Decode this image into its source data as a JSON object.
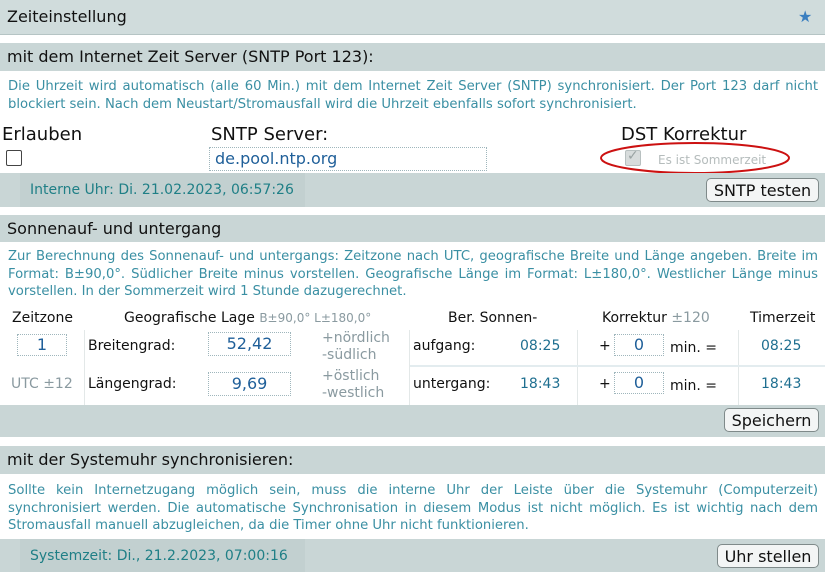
{
  "page": {
    "title": "Zeiteinstellung",
    "star_icon": "star-icon"
  },
  "sntp": {
    "title": "mit dem Internet Zeit Server (SNTP Port 123):",
    "description": "Die Uhrzeit wird automatisch (alle 60 Min.) mit dem Internet Zeit Server (SNTP) synchronisiert. Der Port 123 darf nicht blockiert sein. Nach dem Neustart/Stromausfall wird die Uhrzeit ebenfalls sofort synchronisiert.",
    "allow_label": "Erlauben",
    "allow_checked": false,
    "server_label": "SNTP Server:",
    "server_value": "de.pool.ntp.org",
    "dst_label": "DST Korrektur",
    "dst_checked": true,
    "dst_text": "Es ist Sommerzeit",
    "internal_clock": "Interne Uhr: Di. 21.02.2023, 06:57:26",
    "test_button": "SNTP testen"
  },
  "sun": {
    "title": "Sonnenauf- und untergang",
    "description": "Zur Berechnung des Sonnenauf- und untergangs: Zeitzone nach UTC, geografische Breite und Länge angeben. Breite im Format: B±90,0°. Südlicher Breite minus vorstellen. Geografische Länge im Format: L±180,0°. Westlicher Länge minus vorstellen. In der Sommerzeit wird 1 Stunde dazugerechnet.",
    "headers": {
      "timezone": "Zeitzone",
      "geo": "Geografische Lage",
      "geo_hint": "B±90,0° L±180,0°",
      "sun": "Ber. Sonnen-",
      "correction": "Korrektur",
      "correction_hint": "±120",
      "timer": "Timerzeit"
    },
    "timezone_value": "1",
    "timezone_hint": "UTC ±12",
    "lat_label": "Breitengrad:",
    "lat_value": "52,42",
    "lat_hint_1": "+nördlich",
    "lat_hint_2": "-südlich",
    "lon_label": "Längengrad:",
    "lon_value": "9,69",
    "lon_hint_1": "+östlich",
    "lon_hint_2": "-westlich",
    "sunrise_label": "aufgang:",
    "sunrise_time": "08:25",
    "sunset_label": "untergang:",
    "sunset_time": "18:43",
    "plus": "+",
    "corr_rise": "0",
    "corr_set": "0",
    "min_eq": "min. =",
    "timer_rise": "08:25",
    "timer_set": "18:43",
    "save_button": "Speichern"
  },
  "sys": {
    "title": "mit der Systemuhr synchronisieren:",
    "description": "Sollte kein Internetzugang möglich sein, muss die interne Uhr der Leiste über die Systemuhr (Computerzeit) synchronisiert werden. Die automatische Synchronisation in diesem Modus ist nicht möglich. Es ist wichtig nach dem Stromausfall manuell abzugleichen, da die Timer ohne Uhr nicht funktionieren.",
    "system_time": "Systemzeit: Di., 21.2.2023, 07:00:16",
    "set_button": "Uhr stellen"
  },
  "colors": {
    "bar": "#c9d6d6",
    "accent_text": "#3a8fa3",
    "value_text": "#1f5f99",
    "annotation": "#cc1111"
  }
}
